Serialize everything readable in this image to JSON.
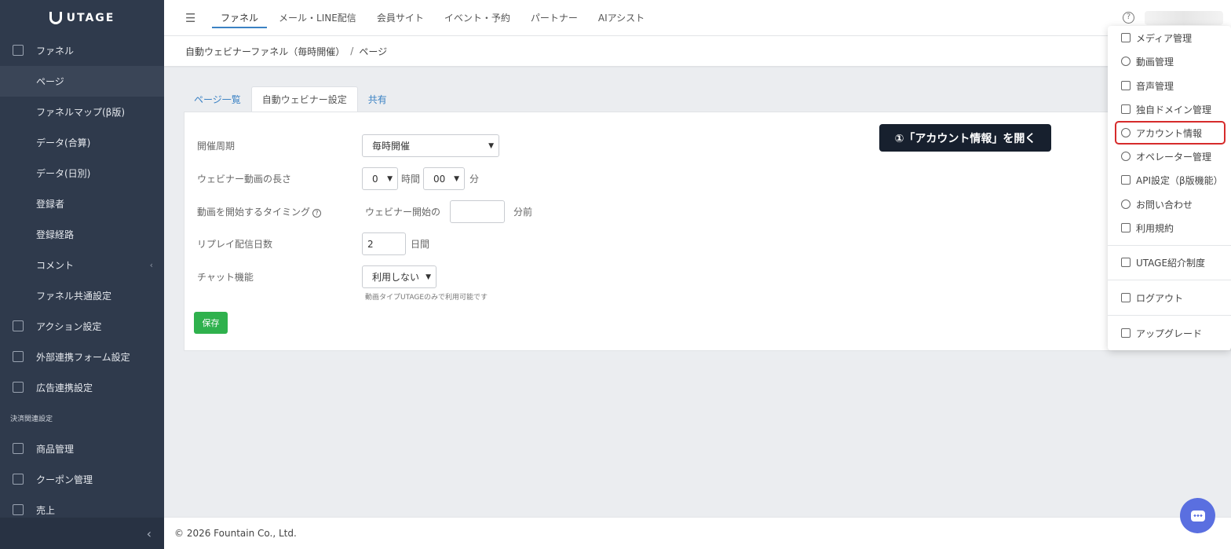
{
  "brand": {
    "name": "UTAGE",
    "accent": "#3b82c4",
    "save_color": "#2fb14d",
    "highlight_color": "#d62b2b"
  },
  "sidebar": {
    "items": [
      {
        "label": "ファネル",
        "icon": "copy-icon"
      },
      {
        "label": "ページ",
        "active": true
      },
      {
        "label": "ファネルマップ(β版)"
      },
      {
        "label": "データ(合算)"
      },
      {
        "label": "データ(日別)"
      },
      {
        "label": "登録者"
      },
      {
        "label": "登録経路"
      },
      {
        "label": "コメント",
        "chevron": "‹"
      },
      {
        "label": "ファネル共通設定"
      },
      {
        "label": "アクション設定",
        "icon": "checkbox-icon"
      },
      {
        "label": "外部連携フォーム設定",
        "icon": "form-icon"
      },
      {
        "label": "広告連携設定",
        "icon": "megaphone-icon"
      }
    ],
    "section_label": "決済関連設定",
    "items2": [
      {
        "label": "商品管理",
        "icon": "basket-icon"
      },
      {
        "label": "クーポン管理",
        "icon": "tag-icon"
      },
      {
        "label": "売上",
        "icon": "yen-icon"
      }
    ],
    "collapse_icon": "‹"
  },
  "topnav": {
    "hamburger": "☰",
    "tabs": [
      "ファネル",
      "メール・LINE配信",
      "会員サイト",
      "イベント・予約",
      "パートナー",
      "AIアシスト"
    ],
    "active_index": 0,
    "help": "?"
  },
  "breadcrumb": {
    "parent": "自動ウェビナーファネル（毎時開催）",
    "separator": "/",
    "current": "ページ"
  },
  "page_tabs": [
    "ページ一覧",
    "自動ウェビナー設定",
    "共有"
  ],
  "form": {
    "cycle": {
      "label": "開催周期",
      "value": "毎時開催"
    },
    "length": {
      "label": "ウェビナー動画の長さ",
      "hours": "0",
      "hours_unit": "時間",
      "minutes": "00",
      "minutes_unit": "分"
    },
    "timing": {
      "label": "動画を開始するタイミング",
      "help": "?",
      "prefix": "ウェビナー開始の",
      "value": "",
      "suffix": "分前"
    },
    "replay": {
      "label": "リプレイ配信日数",
      "value": "2",
      "unit": "日間"
    },
    "chat": {
      "label": "チャット機能",
      "value": "利用しない",
      "hint": "動画タイプUTAGEのみで利用可能です"
    },
    "save": "保存"
  },
  "dropdown": {
    "items": [
      {
        "label": "メディア管理",
        "icon": "folder-icon"
      },
      {
        "label": "動画管理",
        "icon": "play-icon"
      },
      {
        "label": "音声管理",
        "icon": "speaker-icon"
      },
      {
        "label": "独自ドメイン管理",
        "icon": "window-icon"
      },
      {
        "label": "アカウント情報",
        "icon": "user-icon",
        "highlight": true
      },
      {
        "label": "オペレーター管理",
        "icon": "users-icon"
      },
      {
        "label": "API設定（β版機能）",
        "icon": "code-icon"
      },
      {
        "label": "お問い合わせ",
        "icon": "chat-icon"
      },
      {
        "label": "利用規約",
        "icon": "document-icon"
      },
      {
        "label": "UTAGE紹介制度",
        "icon": "handshake-icon"
      },
      {
        "label": "ログアウト",
        "icon": "logout-icon"
      },
      {
        "label": "アップグレード",
        "icon": "upgrade-icon"
      }
    ]
  },
  "tooltip": "①「アカウント情報」を開く",
  "footer": "© 2026 Fountain Co., Ltd."
}
